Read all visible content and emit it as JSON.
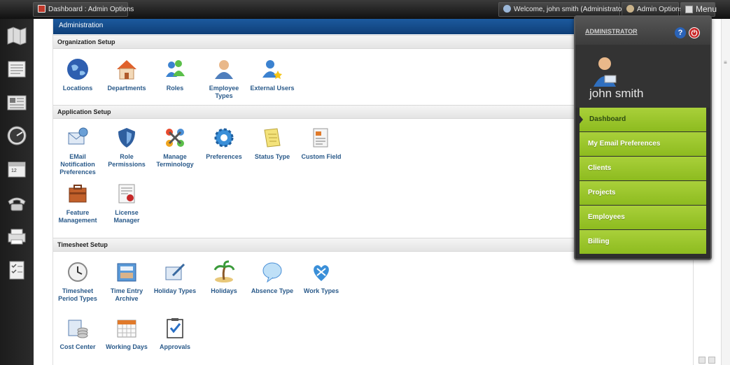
{
  "topbar": {
    "breadcrumb": "Dashboard : Admin Options",
    "welcome": "Welcome, john smith (Administrator)",
    "admin_options": "Admin Options",
    "menu": "Menu"
  },
  "main": {
    "header": "Administration",
    "sections": [
      {
        "title": "Organization Setup",
        "items": [
          "Locations",
          "Departments",
          "Roles",
          "Employee Types",
          "External Users"
        ]
      },
      {
        "title": "Application Setup",
        "items": [
          "EMail Notification Preferences",
          "Role Permissions",
          "Manage Terminology",
          "Preferences",
          "Status Type",
          "Custom Field",
          "Feature Management",
          "License Manager"
        ]
      },
      {
        "title": "Timesheet Setup",
        "items": [
          "Timesheet Period Types",
          "Time Entry Archive",
          "Holiday Types",
          "Holidays",
          "Absence Type",
          "Work Types",
          "Cost Center",
          "Working Days",
          "Approvals"
        ]
      }
    ]
  },
  "menu_panel": {
    "role": "ADMINISTRATOR",
    "help": "?",
    "username": "john smith",
    "items": [
      "Dashboard",
      "My Email Preferences",
      "Clients",
      "Projects",
      "Employees",
      "Billing"
    ]
  },
  "colors": {
    "accent_blue": "#0f3f78",
    "menu_green": "#9cc62c",
    "link_blue": "#2a5a8a"
  }
}
